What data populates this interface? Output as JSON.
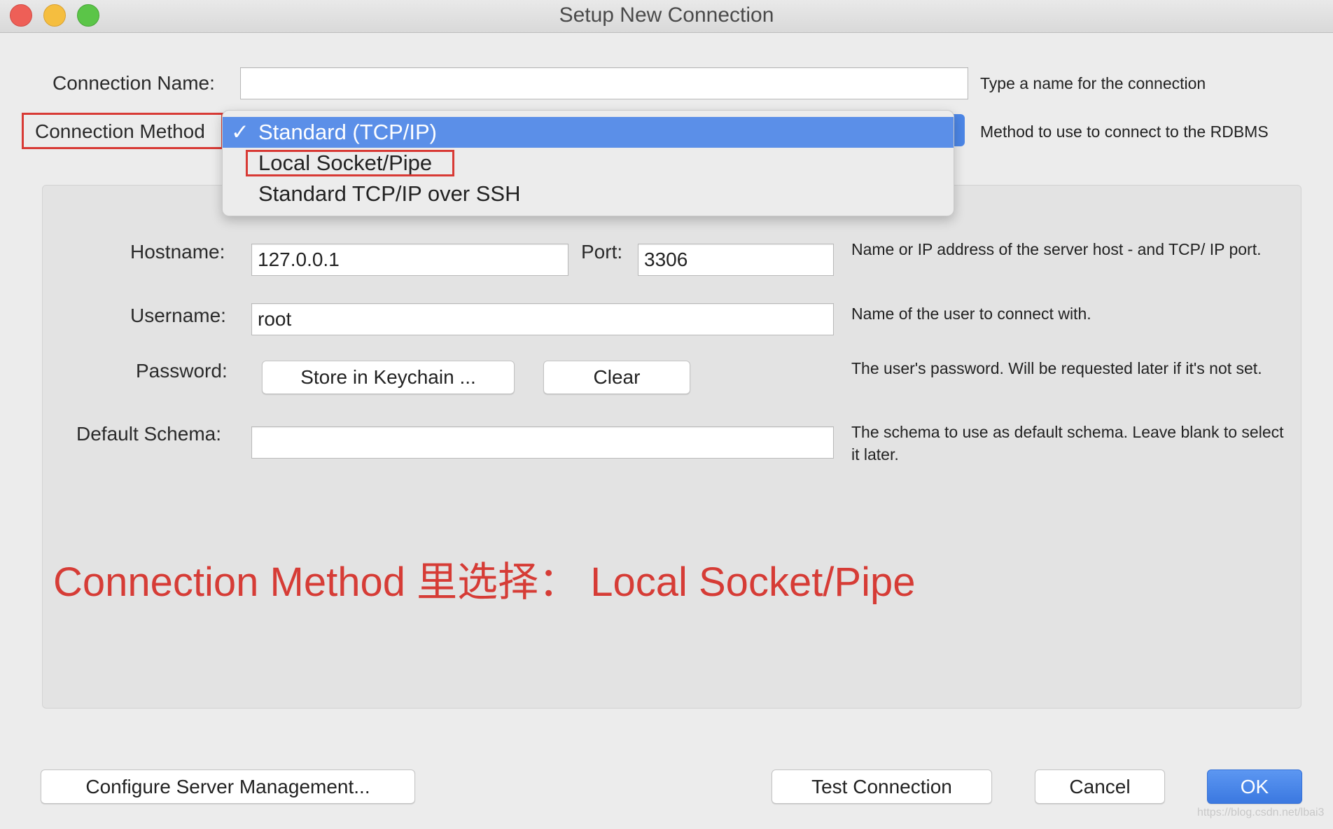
{
  "window": {
    "title": "Setup New Connection"
  },
  "connection_name": {
    "label": "Connection Name:",
    "value": "",
    "help": "Type a name for the connection"
  },
  "connection_method": {
    "label": "Connection Method",
    "help": "Method to use to connect to the RDBMS",
    "options": [
      {
        "label": "Standard (TCP/IP)",
        "selected": true
      },
      {
        "label": "Local Socket/Pipe",
        "selected": false
      },
      {
        "label": "Standard TCP/IP over SSH",
        "selected": false
      }
    ],
    "check_glyph": "✓"
  },
  "params": {
    "hostname": {
      "label": "Hostname:",
      "value": "127.0.0.1"
    },
    "port": {
      "label": "Port:",
      "value": "3306"
    },
    "host_help": "Name or IP address of the server host - and TCP/ IP port.",
    "username": {
      "label": "Username:",
      "value": "root",
      "help": "Name of the user to connect with."
    },
    "password": {
      "label": "Password:",
      "store_button": "Store in Keychain ...",
      "clear_button": "Clear",
      "help": "The user's password. Will be requested later if it's not set."
    },
    "default_schema": {
      "label": "Default Schema:",
      "value": "",
      "help": "The schema to use as default schema. Leave blank to select it later."
    }
  },
  "annotation": "Connection Method 里选择： Local Socket/Pipe",
  "footer": {
    "configure_button": "Configure Server Management...",
    "test_button": "Test Connection",
    "cancel_button": "Cancel",
    "ok_button": "OK"
  },
  "watermark": "https://blog.csdn.net/lbai3",
  "colors": {
    "accent": "#4c86e6",
    "highlight": "#d83a35"
  }
}
